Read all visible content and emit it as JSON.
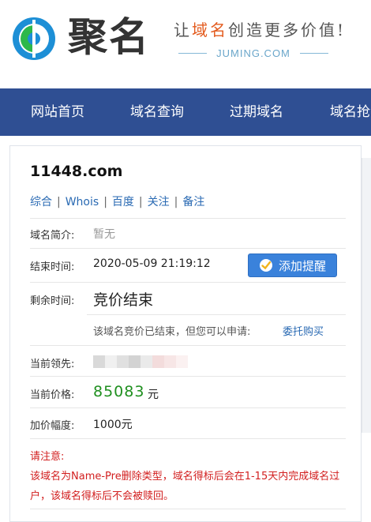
{
  "header": {
    "logo_text": "聚名",
    "slogan_pre": "让",
    "slogan_highlight": "域名",
    "slogan_post": "创造更多价值!",
    "site": "JUMING.COM"
  },
  "nav": {
    "items": [
      {
        "label": "网站首页"
      },
      {
        "label": "域名查询"
      },
      {
        "label": "过期域名"
      },
      {
        "label": "域名抢注"
      }
    ]
  },
  "domain": {
    "name": "11448.com",
    "links": [
      "综合",
      "Whois",
      "百度",
      "关注",
      "备注"
    ]
  },
  "fields": {
    "intro_label": "域名简介:",
    "intro_value": "暂无",
    "end_label": "结束时间:",
    "end_value": "2020-05-09 21:19:12",
    "remind_button": "添加提醒",
    "remaining_label": "剩余时间:",
    "remaining_value": "竞价结束",
    "ended_note": "该域名竞价已结束，但您可以申请:",
    "entrust_link": "委托购买",
    "leader_label": "当前领先:",
    "price_label": "当前价格:",
    "price_value": "85083",
    "price_unit": "元",
    "increment_label": "加价幅度:",
    "increment_value": "1000元"
  },
  "notice": {
    "title": "请注意:",
    "text": "该域名为Name-Pre删除类型，域名得标后会在1-15天内完成域名过户，该域名得标后不会被赎回。"
  },
  "colors": {
    "nav_bg": "#2f4f93",
    "link": "#2a6ab3",
    "price": "#1f8f1f",
    "notice": "#d21f1f",
    "button": "#3a82db"
  }
}
